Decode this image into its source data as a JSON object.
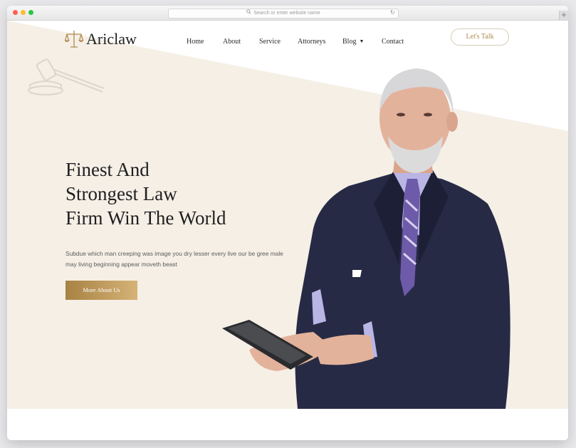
{
  "browser": {
    "url_placeholder": "Search or enter website name",
    "new_tab_label": "+"
  },
  "site": {
    "brand": "Ariclaw",
    "nav": [
      {
        "label": "Home"
      },
      {
        "label": "About"
      },
      {
        "label": "Service"
      },
      {
        "label": "Attorneys"
      },
      {
        "label": "Blog",
        "has_dropdown": true
      },
      {
        "label": "Contact"
      }
    ],
    "cta": "Let's Talk"
  },
  "hero": {
    "headline_lines": [
      "Finest And",
      "Strongest Law",
      "Firm Win The World"
    ],
    "description_lines": [
      "Subdue which man creeping was image you dry lesser every live our be gree male",
      "may living beginning appear moveth beast"
    ],
    "button": "More About Us"
  },
  "colors": {
    "accent_gold": "#b08a4d",
    "hero_background": "#f5efe6",
    "suit_navy": "#262a45"
  }
}
